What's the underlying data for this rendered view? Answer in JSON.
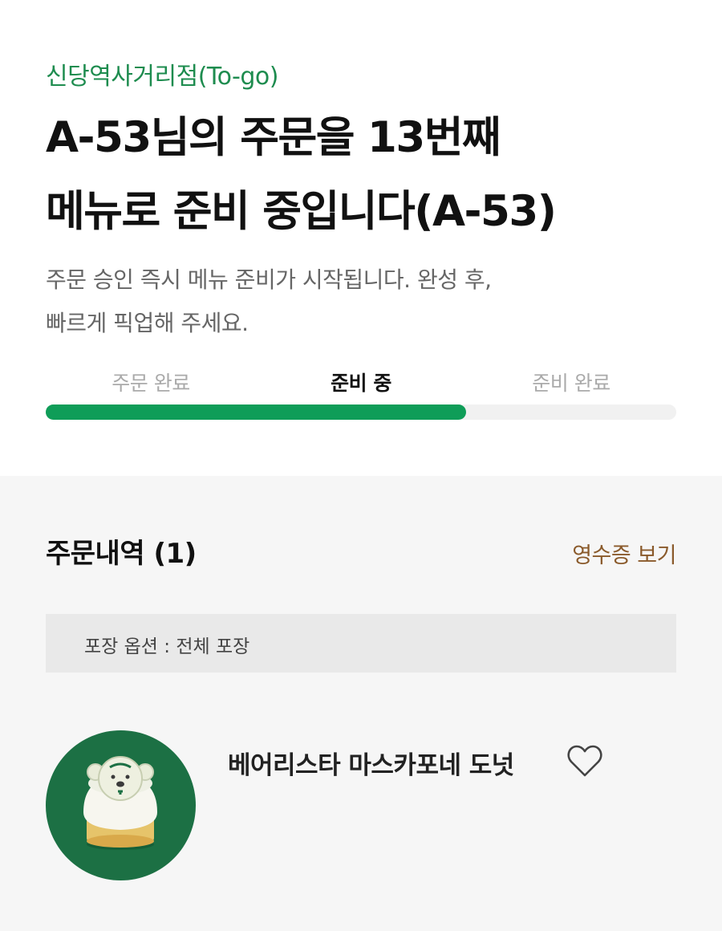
{
  "header": {
    "store_name": "신당역사거리점(To-go)",
    "title_line1": "A-53님의 주문을 13번째",
    "title_line2": "메뉴로 준비 중입니다(A-53)",
    "sub_line1": "주문 승인 즉시 메뉴 준비가 시작됩니다. 완성 후,",
    "sub_line2": "빠르게 픽업해 주세요."
  },
  "progress": {
    "steps": [
      "주문 완료",
      "준비 중",
      "준비 완료"
    ],
    "active_index": 1,
    "fill_fraction": 0.667,
    "fill_color": "#0f9d58"
  },
  "order": {
    "history_label": "주문내역 (1)",
    "receipt_label": "영수증 보기",
    "packaging_option": "포장 옵션 : 전체 포장",
    "items": [
      {
        "name": "베어리스타 마스카포네 도넛",
        "icon": "heart-outline-icon"
      }
    ]
  },
  "colors": {
    "accent_green": "#1e8c4f",
    "receipt_brown": "#8a5a2b",
    "product_bg": "#1c7044"
  }
}
